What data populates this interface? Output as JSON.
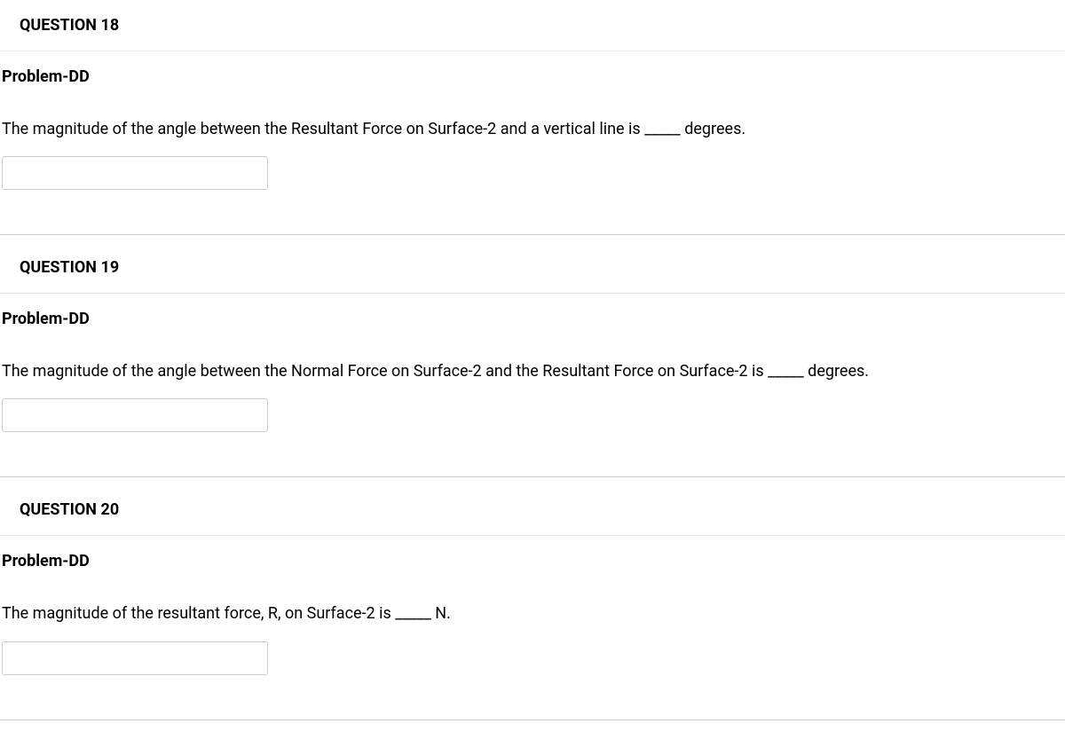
{
  "questions": [
    {
      "header": "QUESTION 18",
      "problem_label": "Problem-DD",
      "text": "The magnitude of the angle between the Resultant Force on Surface-2 and a vertical line is _____ degrees."
    },
    {
      "header": "QUESTION 19",
      "problem_label": "Problem-DD",
      "text": "The magnitude of the angle between the Normal Force on Surface-2 and the Resultant Force on Surface-2 is _____ degrees."
    },
    {
      "header": "QUESTION 20",
      "problem_label": "Problem-DD",
      "text": "The magnitude of the resultant force, R, on Surface-2 is _____ N."
    }
  ]
}
